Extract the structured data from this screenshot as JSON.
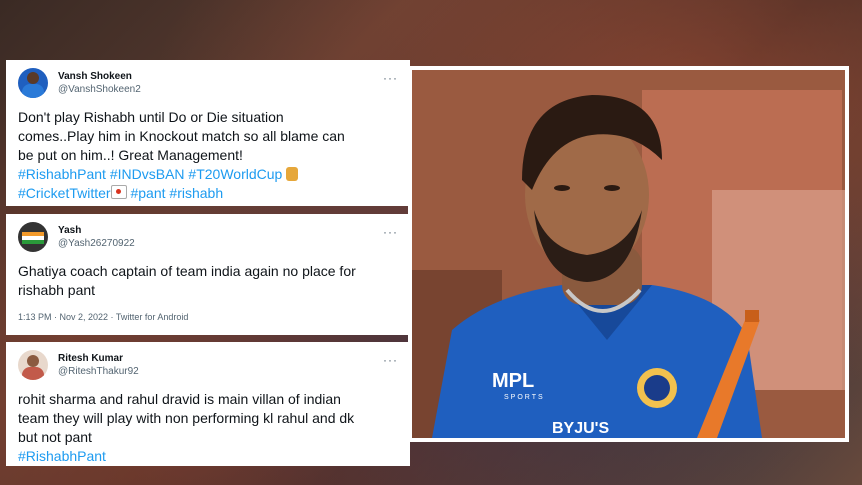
{
  "tweets": [
    {
      "display_name": "Vansh Shokeen",
      "handle": "@VanshShokeen2",
      "more": "···",
      "text_lines": [
        "Don't play Rishabh until Do or Die situation",
        "comes..Play him in Knockout match so all blame can",
        "be put on him..! Great Management!"
      ],
      "hashtag_line_1": [
        "#RishabhPant",
        "#INDvsBAN",
        "#T20WorldCup"
      ],
      "hashtag_line_2": [
        "#CricketTwitter",
        "#pant",
        "#rishabh"
      ]
    },
    {
      "display_name": "Yash",
      "handle": "@Yash26270922",
      "more": "···",
      "text_lines": [
        "Ghatiya coach captain of team india again no place for",
        "rishabh pant"
      ],
      "meta": "1:13 PM · Nov 2, 2022 · Twitter for Android"
    },
    {
      "display_name": "Ritesh Kumar",
      "handle": "@RiteshThakur92",
      "more": "···",
      "text_lines": [
        "rohit sharma and rahul dravid is main villan of indian",
        "team they will play with non performing  kl rahul and dk",
        "but not pant"
      ],
      "hashtag_line_1": [
        "#RishabhPant"
      ]
    }
  ],
  "photo": {
    "jersey_text": "MPL",
    "jersey_subtext": "SPORTS",
    "sponsor_text": "BYJU'S"
  },
  "colors": {
    "hashtag": "#1d9bf0",
    "jersey_blue": "#1f5fbf",
    "bat_orange": "#e8792a"
  }
}
